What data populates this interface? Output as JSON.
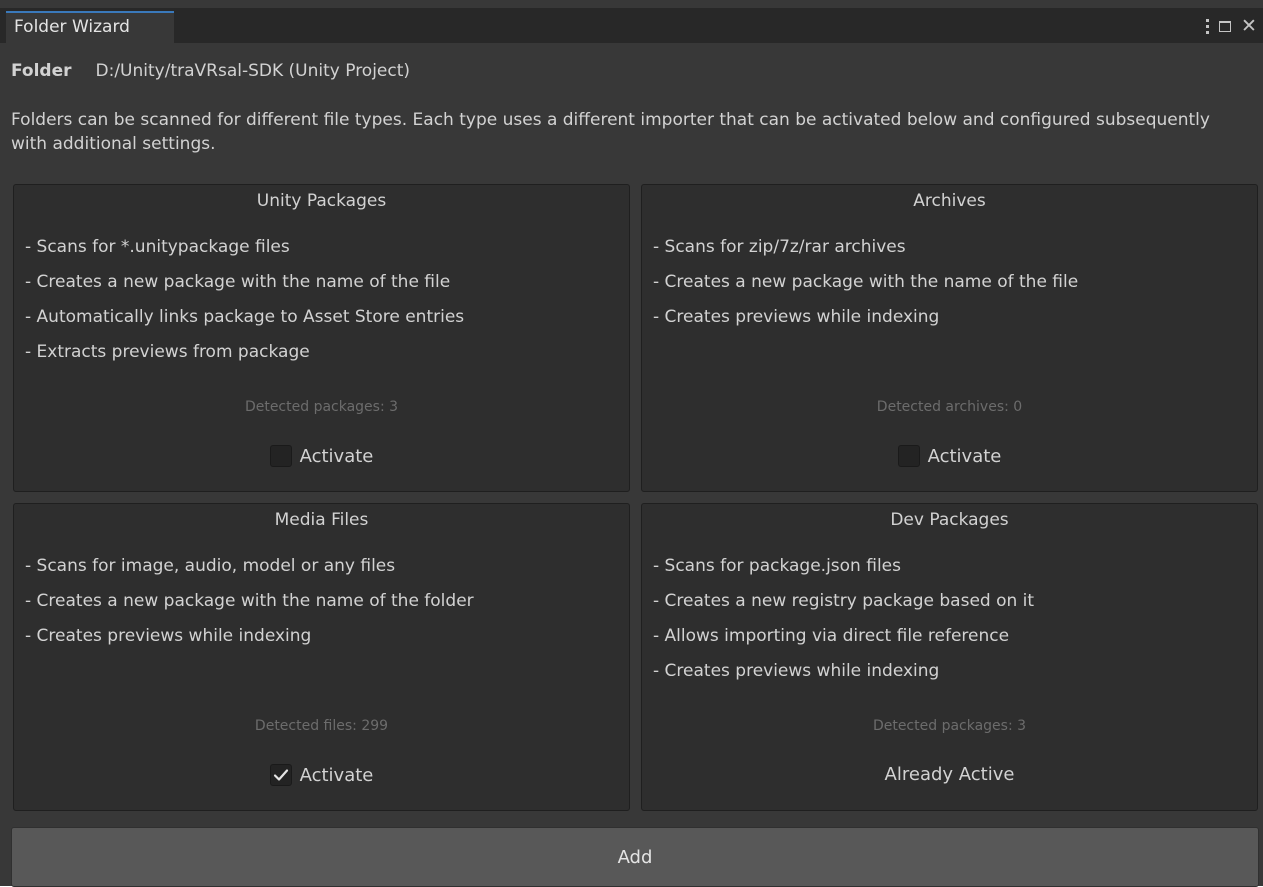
{
  "window": {
    "tab_title": "Folder Wizard"
  },
  "folder": {
    "label": "Folder",
    "path": "D:/Unity/traVRsal-SDK (Unity Project)"
  },
  "description": "Folders can be scanned for different file types. Each type uses a different importer that can be activated below and configured subsequently with additional settings.",
  "cards": [
    {
      "title": "Unity Packages",
      "features": [
        "- Scans for *.unitypackage files",
        "- Creates a new package with the name of the file",
        "- Automatically links package to Asset Store entries",
        "- Extracts previews from package"
      ],
      "count_text": "Detected packages: 3",
      "action_label": "Activate",
      "checked": false
    },
    {
      "title": "Archives",
      "features": [
        "- Scans for zip/7z/rar archives",
        "- Creates a new package with the name of the file",
        "- Creates previews while indexing"
      ],
      "count_text": "Detected archives: 0",
      "action_label": "Activate",
      "checked": false
    },
    {
      "title": "Media Files",
      "features": [
        "- Scans for image, audio, model or any files",
        "- Creates a new package with the name of the folder",
        "- Creates previews while indexing"
      ],
      "count_text": "Detected files: 299",
      "action_label": "Activate",
      "checked": true
    },
    {
      "title": "Dev Packages",
      "features": [
        "- Scans for package.json files",
        "- Creates a new registry package based on it",
        "- Allows importing via direct file reference",
        "- Creates previews while indexing"
      ],
      "count_text": "Detected packages: 3",
      "status_text": "Already Active"
    }
  ],
  "add_button": {
    "label": "Add"
  },
  "icons": {
    "menu": "kebab-menu-icon",
    "maximize": "maximize-icon",
    "close": "close-icon",
    "checkmark": "checkmark-icon"
  }
}
